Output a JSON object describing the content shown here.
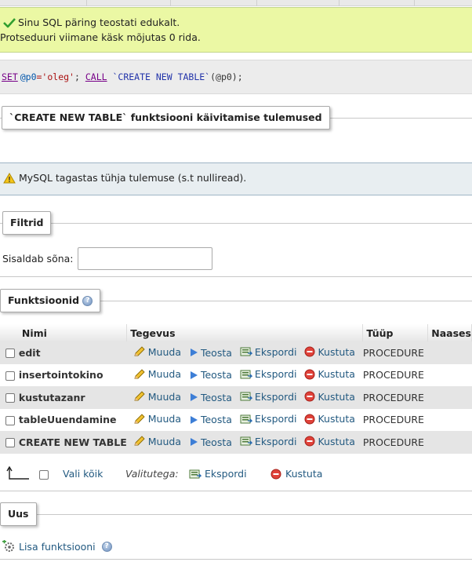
{
  "success": {
    "line1": "Sinu SQL päring teostati edukalt.",
    "line2": "Protseduuri viimane käsk mõjutas 0 rida."
  },
  "sql": {
    "set_kw": "SET",
    "var1": "@p0",
    "eq_str": "='oleg'",
    "semi": ";",
    "call_kw": "CALL",
    "routine": "`CREATE NEW TABLE`",
    "args": "(@p0);"
  },
  "results_legend": "`CREATE NEW TABLE` funktsiooni käivitamise tulemused",
  "notice": "MySQL tagastas tühja tulemuse (s.t nulliread).",
  "filter": {
    "legend": "Filtrid",
    "label": "Sisaldab sõna:",
    "value": ""
  },
  "routines": {
    "legend": "Funktsioonid",
    "headers": {
      "name": "Nimi",
      "action": "Tegevus",
      "type": "Tüüp",
      "returns": "Naases"
    },
    "actions": {
      "edit": "Muuda",
      "execute": "Teosta",
      "export": "Ekspordi",
      "drop": "Kustuta"
    },
    "rows": [
      {
        "name": "edit",
        "type": "PROCEDURE"
      },
      {
        "name": "insertointokino",
        "type": "PROCEDURE"
      },
      {
        "name": "kustutazanr",
        "type": "PROCEDURE"
      },
      {
        "name": "tableUuendamine",
        "type": "PROCEDURE"
      },
      {
        "name": "CREATE NEW TABLE",
        "type": "PROCEDURE"
      }
    ]
  },
  "bulk": {
    "select_all": "Vali kõik",
    "with_selected": "Valitutega:",
    "export": "Ekspordi",
    "drop": "Kustuta"
  },
  "new": {
    "legend": "Uus",
    "add": "Lisa funktsiooni"
  }
}
